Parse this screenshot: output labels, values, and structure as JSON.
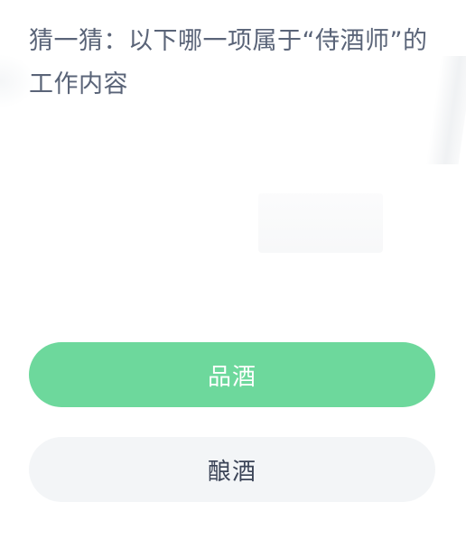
{
  "question": {
    "text": "猜一猜：以下哪一项属于“侍酒师”的工作内容"
  },
  "options": [
    {
      "label": "品酒",
      "state": "selected",
      "color": "#6dd89c"
    },
    {
      "label": "酿酒",
      "state": "default",
      "color": "#f3f5f7"
    }
  ],
  "theme": {
    "question_text_color": "#5a6478",
    "selected_text_color": "#ffffff",
    "default_text_color": "#3b4457"
  }
}
